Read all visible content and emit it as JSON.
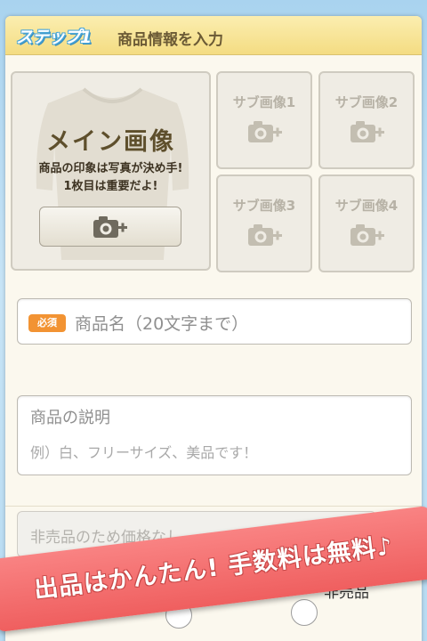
{
  "header": {
    "step_badge": "ステップ1",
    "title": "商品情報を入力"
  },
  "main_image": {
    "title": "メイン画像",
    "description_line1": "商品の印象は写真が決め手!",
    "description_line2": "1枚目は重要だよ!",
    "button_icon": "camera-plus-icon"
  },
  "sub_images": [
    {
      "label": "サブ画像1",
      "icon": "camera-plus-icon"
    },
    {
      "label": "サブ画像2",
      "icon": "camera-plus-icon"
    },
    {
      "label": "サブ画像3",
      "icon": "camera-plus-icon"
    },
    {
      "label": "サブ画像4",
      "icon": "camera-plus-icon"
    }
  ],
  "product_name": {
    "required_badge": "必須",
    "placeholder": "商品名（20文字まで）"
  },
  "description": {
    "label": "商品の説明",
    "placeholder": "例）白、フリーサイズ、美品です！"
  },
  "price": {
    "placeholder": "非売品のため価格なし"
  },
  "sale_options": {
    "not_for_sale_label": "非売品"
  },
  "promo_banner": {
    "text": "出品はかんたん! 手数料は無料♪"
  },
  "colors": {
    "header_yellow": "#f4dc82",
    "required_orange": "#f29333",
    "promo_red": "#ef5f5f",
    "card_bg": "#fbf8ee"
  }
}
